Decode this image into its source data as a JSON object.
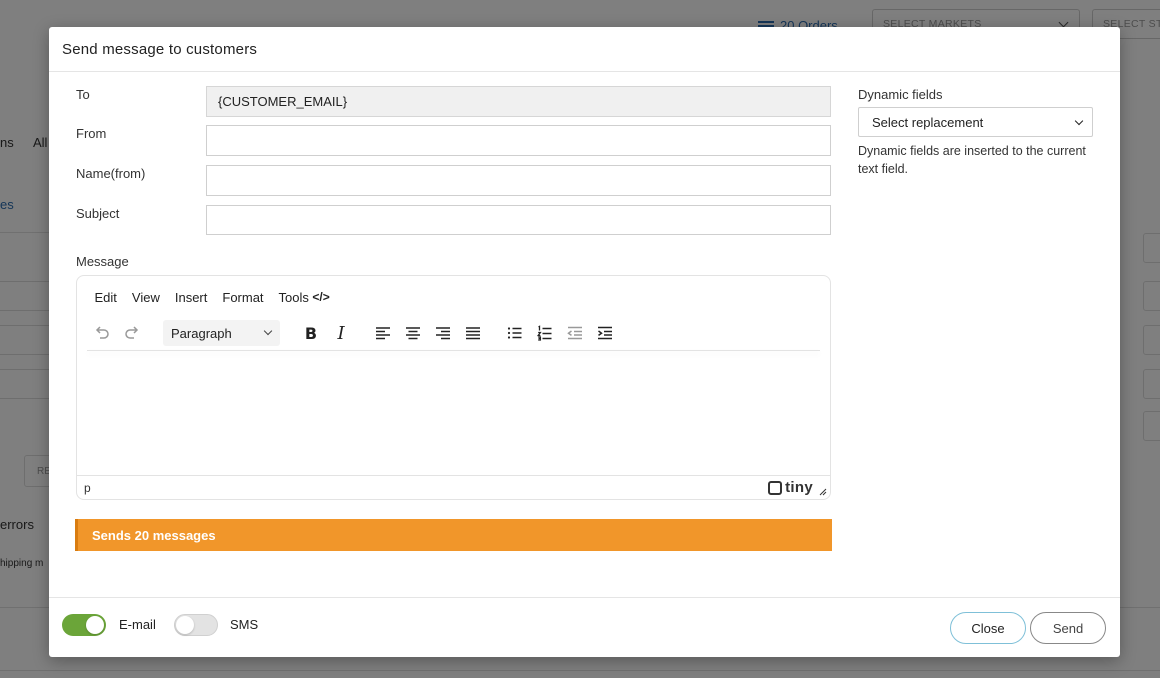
{
  "background": {
    "orders_link": "20 Orders",
    "select_markets": "SELECT MARKETS",
    "select_stores": "SELECT STO",
    "fragments": {
      "ns": "ns",
      "all": "All",
      "es": "es",
      "re": "RE",
      "errors": "errors",
      "shipping": "hipping m"
    }
  },
  "modal": {
    "title": "Send message to customers",
    "form": {
      "to": {
        "label": "To",
        "value": "{CUSTOMER_EMAIL}"
      },
      "from": {
        "label": "From",
        "value": ""
      },
      "name_from": {
        "label": "Name(from)",
        "value": ""
      },
      "subject": {
        "label": "Subject",
        "value": ""
      },
      "message_label": "Message"
    },
    "dynamic_fields": {
      "label": "Dynamic fields",
      "select_value": "Select replacement",
      "help": "Dynamic fields are inserted to the current text field."
    },
    "editor": {
      "menu": [
        "Edit",
        "View",
        "Insert",
        "Format",
        "Tools"
      ],
      "code_icon_text": "</>",
      "block_format": "Paragraph",
      "status_path": "p",
      "brand": "tiny"
    },
    "notice": "Sends 20 messages",
    "footer": {
      "email_label": "E-mail",
      "email_on": true,
      "sms_label": "SMS",
      "sms_on": false,
      "close_label": "Close",
      "send_label": "Send"
    }
  },
  "colors": {
    "accent_orange": "#f1962a",
    "toggle_on": "#6ba539",
    "link_blue": "#2b6cb0"
  }
}
